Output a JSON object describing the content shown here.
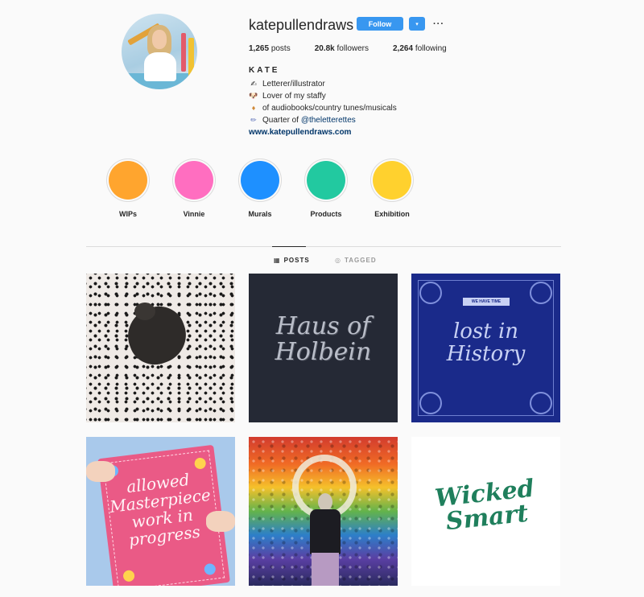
{
  "profile": {
    "username": "katepullendraws",
    "follow_label": "Follow",
    "dropdown_glyph": "▾",
    "more_glyph": "···",
    "stats": {
      "posts_count": "1,265",
      "posts_label": "posts",
      "followers_count": "20.8k",
      "followers_label": "followers",
      "following_count": "2,264",
      "following_label": "following"
    },
    "full_name": "KATE",
    "bio": {
      "line1": "Letterer/illustrator",
      "line2": "Lover of my staffy",
      "line3": "of audiobooks/country tunes/musicals",
      "line4_prefix": "Quarter of ",
      "line4_mention": "@theletterettes"
    },
    "website": "www.katepullendraws.com"
  },
  "highlights": [
    {
      "label": "WIPs",
      "color": "#ffa52e"
    },
    {
      "label": "Vinnie",
      "color": "#ff6ec0"
    },
    {
      "label": "Murals",
      "color": "#1e90ff"
    },
    {
      "label": "Products",
      "color": "#22c9a0"
    },
    {
      "label": "Exhibition",
      "color": "#ffd12e"
    }
  ],
  "tabs": {
    "posts": "POSTS",
    "tagged": "TAGGED"
  },
  "posts": {
    "p2_text": "Haus of Holbein",
    "p3_banner": "WE HAVE TIME",
    "p3_text": "lost in History",
    "p4_text": "allowed Masterpiece work in progress",
    "p6_text": "Wicked Smart"
  },
  "icons": {
    "dropdown": "chevron-down-icon",
    "more": "more-options-icon",
    "posts_tab": "grid-icon",
    "tagged_tab": "tag-user-icon"
  },
  "colors": {
    "accent": "#3897f0",
    "link": "#003569"
  }
}
